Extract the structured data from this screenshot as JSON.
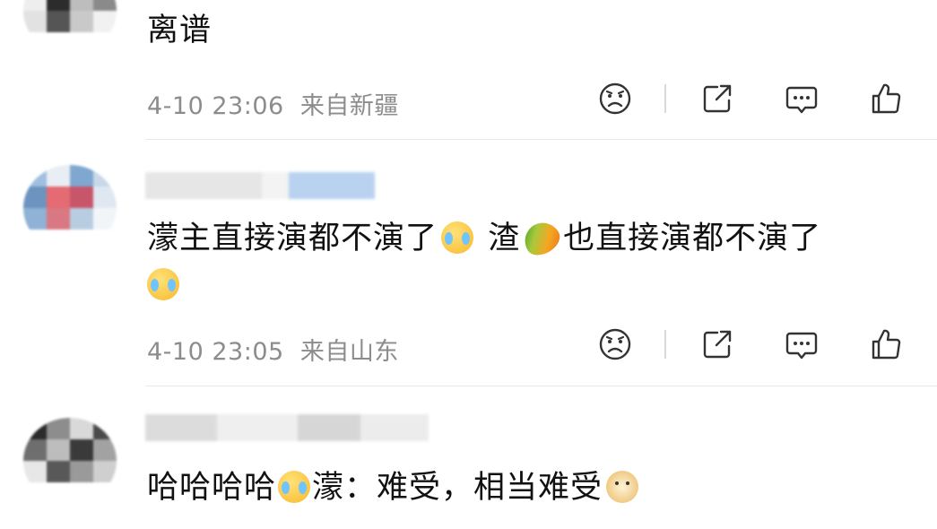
{
  "comments": [
    {
      "username": "",
      "text": "离谱",
      "time": "4-10 23:06",
      "location": "来自新疆",
      "avatar_colors": [
        "#d8d8d8",
        "#3b3b3b",
        "#cfcfcf",
        "#6b6b6b",
        "#eeeeee",
        "#2c2c2c",
        "#bdbdbd",
        "#8a8a8a",
        "#e2e2e2",
        "#555555",
        "#c9c9c9",
        "#f1f1f1"
      ]
    },
    {
      "username": "",
      "text_parts": [
        "濛主直接演都不演了",
        "渣",
        "也直接演都不演了"
      ],
      "emojis": [
        "cry-laugh-emoji",
        "mango-emoji",
        "cry-laugh-emoji"
      ],
      "time": "4-10 23:05",
      "location": "来自山东",
      "avatar_colors": [
        "#9fc0e0",
        "#e8eef4",
        "#7fa7cf",
        "#c8d8e8",
        "#6c94bf",
        "#e46b73",
        "#c8556a",
        "#dfe8f1",
        "#8fb2d6",
        "#d97882",
        "#b9cde2",
        "#f2f5f8"
      ]
    },
    {
      "username": "",
      "text_parts": [
        "哈哈哈哈",
        "濛：难受，相当难受"
      ],
      "emojis": [
        "cry-laugh-emoji",
        "doge-emoji"
      ],
      "time": "",
      "location": "",
      "avatar_colors": [
        "#2b2b2b",
        "#8d8d8d",
        "#d9d9d9",
        "#4a4a4a",
        "#6e6e6e",
        "#bdbdbd",
        "#3a3a3a",
        "#a2a2a2",
        "#e7e7e7",
        "#585858",
        "#9a9a9a",
        "#cfcfcf"
      ]
    }
  ],
  "actions": {
    "dislike": "sad-face-icon",
    "share": "share-icon",
    "reply": "comment-bubble-icon",
    "like": "thumbs-up-icon"
  }
}
